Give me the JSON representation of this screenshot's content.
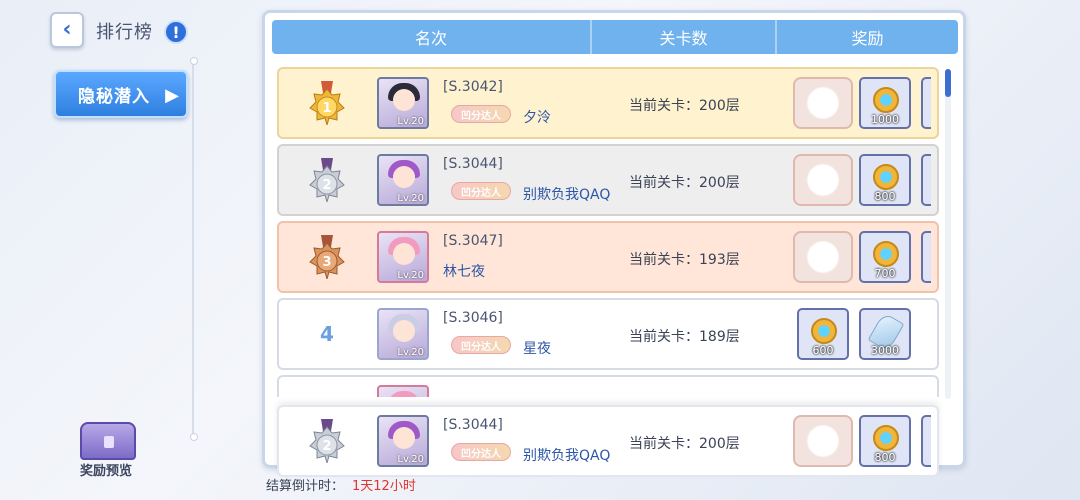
{
  "nav": {
    "back_icon": "chevron-left-icon",
    "title": "排行榜",
    "info_icon": "info-icon",
    "info_glyph": "!"
  },
  "sidebar": {
    "tabs": [
      {
        "label": "隐秘潜入",
        "active": true
      }
    ]
  },
  "reward_preview": {
    "icon": "treasure-chest-icon",
    "label": "奖励预览"
  },
  "table": {
    "headers": {
      "rank": "名次",
      "stage": "关卡数",
      "reward": "奖励"
    },
    "rows": [
      {
        "rank": "1",
        "medal": "gold",
        "avatar_level": "Lv.20",
        "server": "[S.3042]",
        "badge": "凹分达人",
        "name": "夕泠",
        "stage": "当前关卡：200层",
        "rewards": [
          {
            "icon": "gift-box-icon",
            "amount": ""
          },
          {
            "icon": "gem-coin-icon",
            "amount": "1000"
          }
        ]
      },
      {
        "rank": "2",
        "medal": "silver",
        "avatar_level": "Lv.20",
        "server": "[S.3044]",
        "badge": "凹分达人",
        "name": "别欺负我QAQ",
        "stage": "当前关卡：200层",
        "rewards": [
          {
            "icon": "gift-box-icon",
            "amount": ""
          },
          {
            "icon": "gem-coin-icon",
            "amount": "800"
          }
        ]
      },
      {
        "rank": "3",
        "medal": "bronze",
        "avatar_level": "Lv.20",
        "server": "[S.3047]",
        "badge": "",
        "name": "林七夜",
        "stage": "当前关卡：193层",
        "rewards": [
          {
            "icon": "gift-box-icon",
            "amount": ""
          },
          {
            "icon": "gem-coin-icon",
            "amount": "700"
          }
        ]
      },
      {
        "rank": "4",
        "medal": "",
        "avatar_level": "Lv.20",
        "server": "[S.3046]",
        "badge": "凹分达人",
        "name": "星夜",
        "stage": "当前关卡：189层",
        "rewards": [
          {
            "icon": "gem-coin-icon",
            "amount": "600"
          },
          {
            "icon": "crystal-icon",
            "amount": "3000"
          }
        ]
      }
    ],
    "my_rank": {
      "rank": "2",
      "medal": "silver",
      "avatar_level": "Lv.20",
      "server": "[S.3044]",
      "badge": "凹分达人",
      "name": "别欺负我QAQ",
      "stage": "当前关卡：200层",
      "rewards": [
        {
          "icon": "gift-box-icon",
          "amount": ""
        },
        {
          "icon": "gem-coin-icon",
          "amount": "800"
        }
      ]
    }
  },
  "countdown": {
    "label": "结算倒计时：",
    "value": "1天12小时"
  },
  "colors": {
    "accent": "#2f7fe0",
    "header": "#6fb2ee",
    "gold_row": "#fff2cf",
    "silver_row": "#eeeeee",
    "bronze_row": "#ffe6d8",
    "countdown_value": "#e0342c"
  }
}
